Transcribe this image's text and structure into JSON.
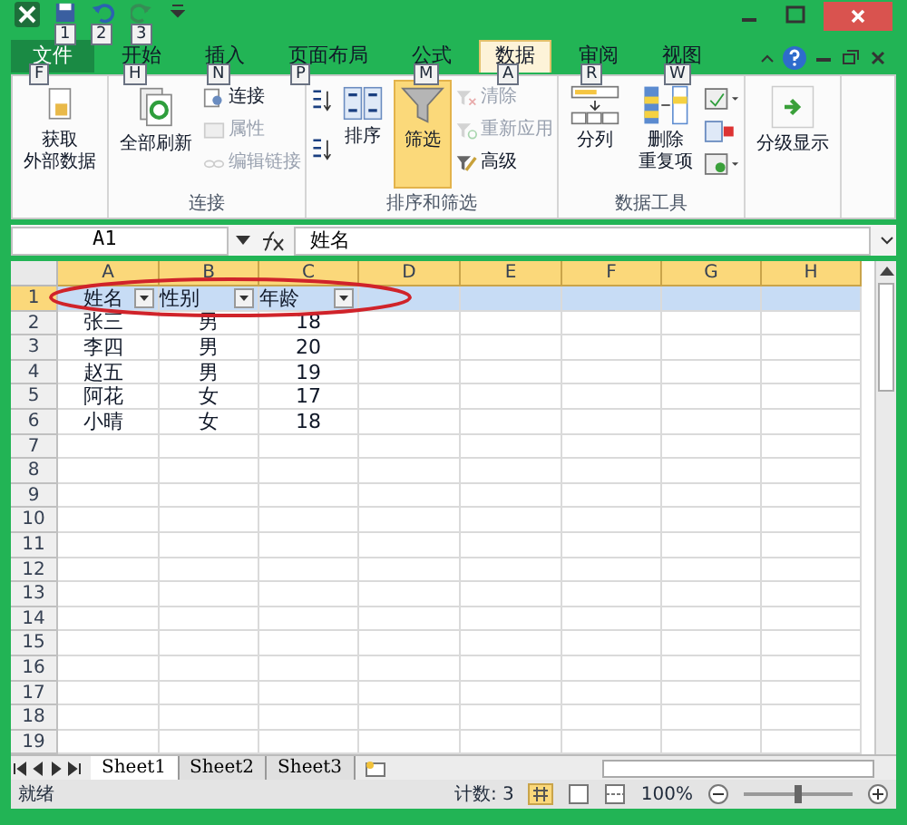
{
  "quick_access": [
    {
      "keytip": "1",
      "kind": "save",
      "disabled": false
    },
    {
      "keytip": "2",
      "kind": "undo",
      "disabled": false
    },
    {
      "keytip": "3",
      "kind": "redo",
      "disabled": true
    }
  ],
  "tabs": [
    {
      "label": "文件",
      "keytip": "F",
      "selected": false,
      "kind": "file"
    },
    {
      "label": "开始",
      "keytip": "H",
      "selected": false,
      "kind": "tab"
    },
    {
      "label": "插入",
      "keytip": "N",
      "selected": false,
      "kind": "tab"
    },
    {
      "label": "页面布局",
      "keytip": "P",
      "selected": false,
      "kind": "tab"
    },
    {
      "label": "公式",
      "keytip": "M",
      "selected": false,
      "kind": "tab"
    },
    {
      "label": "数据",
      "keytip": "A",
      "selected": true,
      "kind": "tab"
    },
    {
      "label": "审阅",
      "keytip": "R",
      "selected": false,
      "kind": "tab"
    },
    {
      "label": "视图",
      "keytip": "W",
      "selected": false,
      "kind": "tab"
    }
  ],
  "ribbon_groups": [
    {
      "items": [
        {
          "kind": "large",
          "lines": [
            "获取",
            "外部数据"
          ],
          "disabled": false,
          "on": false
        }
      ]
    },
    {
      "label": "连接",
      "items": [
        {
          "kind": "large",
          "lines": [
            "全部刷新"
          ],
          "disabled": false,
          "on": false
        },
        {
          "kind": "small",
          "label": "连接",
          "disabled": false
        },
        {
          "kind": "small",
          "label": "属性",
          "disabled": true
        },
        {
          "kind": "small",
          "label": "编辑链接",
          "disabled": true
        }
      ]
    },
    {
      "label": "排序和筛选",
      "items": [
        {
          "kind": "sortpair"
        },
        {
          "kind": "large",
          "lines": [
            "排序"
          ],
          "disabled": false,
          "on": false
        },
        {
          "kind": "large",
          "lines": [
            "筛选"
          ],
          "disabled": false,
          "on": true
        },
        {
          "kind": "small",
          "label": "清除",
          "disabled": true
        },
        {
          "kind": "small",
          "label": "重新应用",
          "disabled": true
        },
        {
          "kind": "small",
          "label": "高级",
          "disabled": false
        }
      ]
    },
    {
      "label": "数据工具",
      "items": [
        {
          "kind": "large",
          "lines": [
            "分列"
          ],
          "disabled": false,
          "on": false
        },
        {
          "kind": "large",
          "lines": [
            "删除",
            "重复项"
          ],
          "disabled": false,
          "on": false
        },
        {
          "kind": "iconcol"
        }
      ]
    },
    {
      "items": [
        {
          "kind": "large",
          "lines": [
            "分级显示"
          ],
          "disabled": false,
          "on": false
        }
      ]
    }
  ],
  "formula_bar": {
    "name_box": "A1",
    "value": "姓名"
  },
  "columns": [
    "A",
    "B",
    "C",
    "D",
    "E",
    "F",
    "G",
    "H"
  ],
  "rows": [
    {
      "number": "1",
      "selected": true,
      "cells": [
        {
          "text": "姓名",
          "filter": true
        },
        {
          "text": "性别",
          "filter": true
        },
        {
          "text": "年龄",
          "filter": true
        }
      ]
    },
    {
      "number": "2",
      "selected": false,
      "cells": [
        {
          "text": "张三",
          "filter": false
        },
        {
          "text": "男",
          "filter": false
        },
        {
          "text": "18",
          "filter": false
        }
      ]
    },
    {
      "number": "3",
      "selected": false,
      "cells": [
        {
          "text": "李四",
          "filter": false
        },
        {
          "text": "男",
          "filter": false
        },
        {
          "text": "20",
          "filter": false
        }
      ]
    },
    {
      "number": "4",
      "selected": false,
      "cells": [
        {
          "text": "赵五",
          "filter": false
        },
        {
          "text": "男",
          "filter": false
        },
        {
          "text": "19",
          "filter": false
        }
      ]
    },
    {
      "number": "5",
      "selected": false,
      "cells": [
        {
          "text": "阿花",
          "filter": false
        },
        {
          "text": "女",
          "filter": false
        },
        {
          "text": "17",
          "filter": false
        }
      ]
    },
    {
      "number": "6",
      "selected": false,
      "cells": [
        {
          "text": "小晴",
          "filter": false
        },
        {
          "text": "女",
          "filter": false
        },
        {
          "text": "18",
          "filter": false
        }
      ]
    },
    {
      "number": "7",
      "selected": false,
      "cells": []
    },
    {
      "number": "8",
      "selected": false,
      "cells": []
    },
    {
      "number": "9",
      "selected": false,
      "cells": []
    },
    {
      "number": "10",
      "selected": false,
      "cells": []
    },
    {
      "number": "11",
      "selected": false,
      "cells": []
    },
    {
      "number": "12",
      "selected": false,
      "cells": []
    },
    {
      "number": "13",
      "selected": false,
      "cells": []
    },
    {
      "number": "14",
      "selected": false,
      "cells": []
    },
    {
      "number": "15",
      "selected": false,
      "cells": []
    },
    {
      "number": "16",
      "selected": false,
      "cells": []
    },
    {
      "number": "17",
      "selected": false,
      "cells": []
    },
    {
      "number": "18",
      "selected": false,
      "cells": []
    },
    {
      "number": "19",
      "selected": false,
      "cells": []
    }
  ],
  "sheet_tabs": [
    {
      "label": "Sheet1",
      "selected": true
    },
    {
      "label": "Sheet2",
      "selected": false
    },
    {
      "label": "Sheet3",
      "selected": false
    }
  ],
  "status_bar": {
    "mode": "就绪",
    "count": "计数: 3",
    "zoom": "100%",
    "zoom_slider": {
      "level": 0.5
    }
  }
}
